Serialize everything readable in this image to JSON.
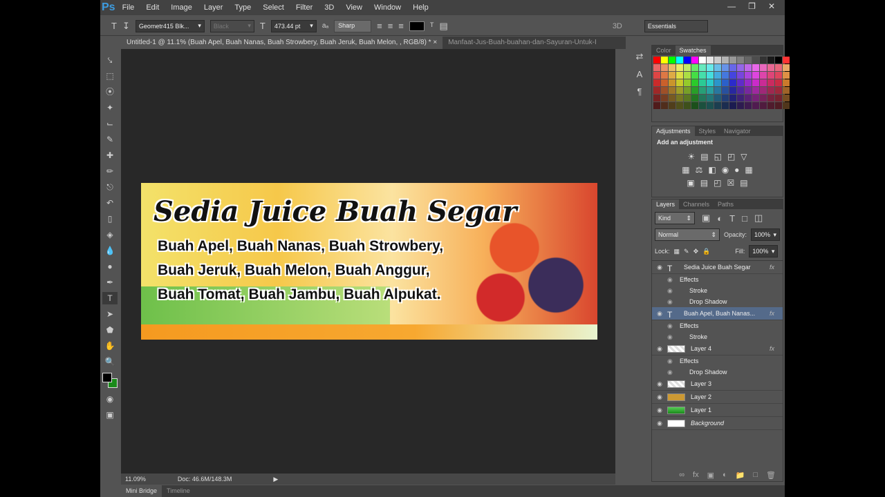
{
  "menubar": {
    "logo": "Ps",
    "items": [
      "File",
      "Edit",
      "Image",
      "Layer",
      "Type",
      "Select",
      "Filter",
      "3D",
      "View",
      "Window",
      "Help"
    ],
    "window_buttons": [
      "minimize",
      "restore",
      "close"
    ]
  },
  "options": {
    "tool_icon": "T",
    "font_family": "Geometr415 Blk...",
    "font_style": "Black",
    "font_size": "473.44 pt",
    "aa_label": "aₐ",
    "antialias": "Sharp",
    "text_color": "#000000",
    "workspace_3d": "3D",
    "workspace": "Essentials"
  },
  "tabs": [
    {
      "label": "Untitled-1 @ 11.1% (Buah Apel, Buah Nanas, Buah Strowbery, Buah Jeruk, Buah Melon, , RGB/8) *",
      "close": "×"
    },
    {
      "label": "Manfaat-Jus-Buah-buahan-dan-Sayuran-Untuk-I"
    }
  ],
  "document": {
    "headline": "Sedia Juice Buah Segar",
    "lines": [
      "Buah Apel, Buah Nanas, Buah Strowbery,",
      "Buah Jeruk, Buah Melon, Buah Anggur,",
      "Buah Tomat, Buah Jambu, Buah Alpukat."
    ]
  },
  "status": {
    "zoom": "11.09%",
    "doc": "Doc: 46.6M/148.3M"
  },
  "bottom_tabs": [
    "Mini Bridge",
    "Timeline"
  ],
  "swatches_panel": {
    "tabs": [
      "Color",
      "Swatches"
    ]
  },
  "adjustments_panel": {
    "tabs": [
      "Adjustments",
      "Styles",
      "Navigator"
    ],
    "title": "Add an adjustment"
  },
  "layers_panel": {
    "tabs": [
      "Layers",
      "Channels",
      "Paths"
    ],
    "kind": "Kind",
    "blend_mode": "Normal",
    "opacity_label": "Opacity:",
    "opacity": "100%",
    "lock_label": "Lock:",
    "fill_label": "Fill:",
    "fill": "100%",
    "layers": [
      {
        "name": "Sedia Juice Buah Segar",
        "type": "text",
        "fx": "fx"
      },
      {
        "name": "Effects",
        "type": "sub1"
      },
      {
        "name": "Stroke",
        "type": "sub2"
      },
      {
        "name": "Drop Shadow",
        "type": "sub2"
      },
      {
        "name": "Buah Apel, Buah Nanas...",
        "type": "text",
        "fx": "fx",
        "selected": true
      },
      {
        "name": "Effects",
        "type": "sub1"
      },
      {
        "name": "Stroke",
        "type": "sub2"
      },
      {
        "name": "Layer 4",
        "type": "image",
        "fx": "fx"
      },
      {
        "name": "Effects",
        "type": "sub1"
      },
      {
        "name": "Drop Shadow",
        "type": "sub2"
      },
      {
        "name": "Layer 3",
        "type": "image"
      },
      {
        "name": "Layer 2",
        "type": "image"
      },
      {
        "name": "Layer 1",
        "type": "image"
      },
      {
        "name": "Background",
        "type": "background"
      }
    ]
  },
  "colors": {
    "foreground": "#000000",
    "background": "#1a8a1a",
    "accent": "#3d9ce0"
  }
}
